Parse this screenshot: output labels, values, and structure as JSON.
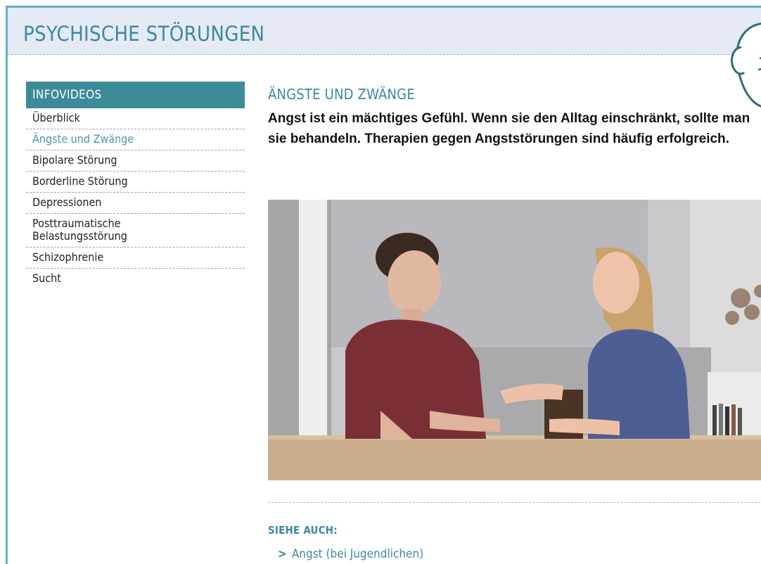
{
  "header": {
    "title": "PSYCHISCHE STÖRUNGEN"
  },
  "sidebar": {
    "heading": "INFOVIDEOS",
    "items": [
      {
        "label": "Überblick",
        "active": false
      },
      {
        "label": "Ängste und Zwänge",
        "active": true
      },
      {
        "label": "Bipolare Störung",
        "active": false
      },
      {
        "label": "Borderline Störung",
        "active": false
      },
      {
        "label": "Depressionen",
        "active": false
      },
      {
        "label": "Posttraumatische",
        "label2": "Belastungsstörung",
        "active": false
      },
      {
        "label": "Schizophrenie",
        "active": false
      },
      {
        "label": "Sucht",
        "active": false
      }
    ]
  },
  "article": {
    "title": "ÄNGSTE UND ZWÄNGE",
    "lead": "Angst ist ein mächtiges Gefühl. Wenn sie den Alltag einschränkt, sollte man sie behandeln. Therapien gegen Angststörungen sind häufig erfolgreich."
  },
  "see_also": {
    "heading": "SIEHE AUCH:",
    "links": [
      {
        "label": "Angst (bei Jugendlichen)"
      }
    ]
  },
  "colors": {
    "accent": "#3a8aa0",
    "sidebar_heading_bg": "#3d8b98",
    "header_bg": "#e6eaf4",
    "frame": "#5fb6c9"
  },
  "icons": {
    "see_also_link": "chevron-right-icon",
    "mascot": "mascot-face-icon"
  }
}
